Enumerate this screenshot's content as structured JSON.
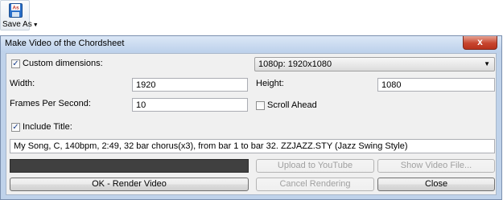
{
  "toolbar": {
    "save_as_label": "Save As",
    "save_as_icon": "floppy-disk-icon",
    "save_as_badge": "As"
  },
  "dialog": {
    "title": "Make Video of the Chordsheet",
    "close_glyph": "x",
    "custom_dimensions": {
      "label": "Custom dimensions:",
      "checked": true
    },
    "resolution_select": {
      "value": "1080p: 1920x1080"
    },
    "width": {
      "label": "Width:",
      "value": "1920"
    },
    "height": {
      "label": "Height:",
      "value": "1080"
    },
    "fps": {
      "label": "Frames Per Second:",
      "value": "10"
    },
    "scroll_ahead": {
      "label": "Scroll Ahead",
      "checked": false
    },
    "include_title": {
      "label": "Include Title:",
      "checked": true
    },
    "title_text": {
      "value": "My Song, C, 140bpm, 2:49, 32 bar chorus(x3), from bar 1 to bar 32. ZZJAZZ.STY (Jazz Swing Style)"
    },
    "buttons": {
      "upload": "Upload to YouTube",
      "show_file": "Show Video File...",
      "ok": "OK - Render Video",
      "cancel": "Cancel Rendering",
      "close": "Close"
    }
  },
  "colors": {
    "title_bar": "#bdd1eb",
    "close_button": "#c7452e",
    "progress_fill": "#404040"
  }
}
